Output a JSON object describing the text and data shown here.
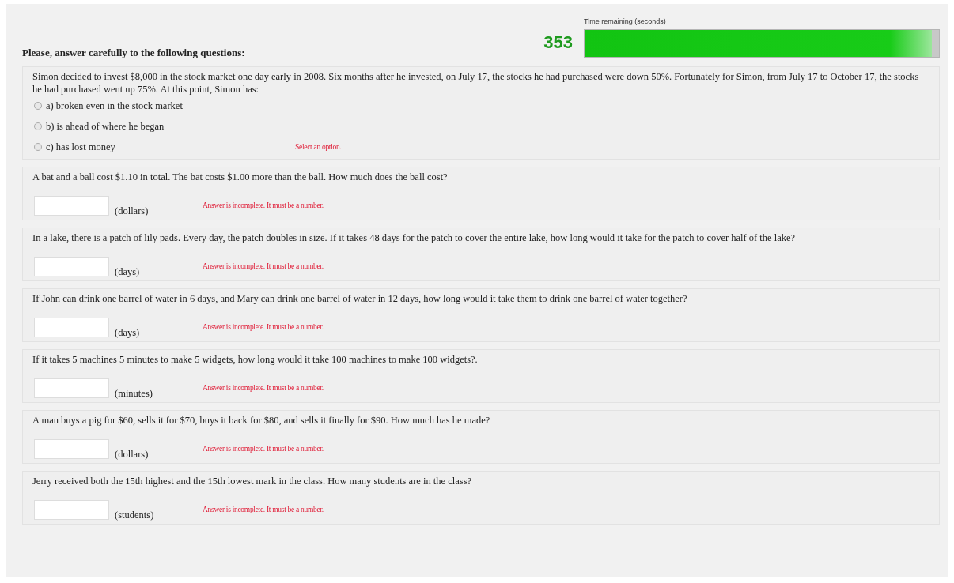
{
  "header": {
    "instruction": "Please, answer carefully to the following questions:"
  },
  "timer": {
    "label": "Time remaining (seconds)",
    "value": "353",
    "level": 0.98
  },
  "questions": [
    {
      "kind": "choice",
      "text": "Simon decided to invest $8,000 in the stock market one day early in 2008. Six months after he invested, on July 17, the stocks he had purchased were down 50%. Fortunately for Simon, from July 17 to October 17, the stocks he had purchased went up 75%. At this point, Simon has:",
      "options": [
        {
          "label": "a) broken even in the stock market",
          "selected": false
        },
        {
          "label": "b) is ahead of where he began",
          "selected": false
        },
        {
          "label": "c) has lost money",
          "selected": false
        }
      ],
      "error": "Select an option."
    },
    {
      "kind": "number",
      "text": "A bat and a ball cost $1.10 in total. The bat costs $1.00 more than the ball. How much does the ball cost?",
      "unit": "(dollars)",
      "error": "Answer is incomplete. It must be a number."
    },
    {
      "kind": "number",
      "text": "In a lake, there is a patch of lily pads. Every day, the patch doubles in size. If it takes 48 days for the patch to cover the entire lake, how long would it take for the patch to cover half of the lake?",
      "unit": "(days)",
      "error": "Answer is incomplete. It must be a number."
    },
    {
      "kind": "number",
      "text": "If John can drink one barrel of water in 6 days, and Mary can drink one barrel of water in 12 days, how long would it take them to drink one barrel of water together?",
      "unit": "(days)",
      "error": "Answer is incomplete. It must be a number."
    },
    {
      "kind": "number",
      "text": "If it takes 5 machines 5 minutes to make 5 widgets, how long would it take 100 machines to make 100 widgets?.",
      "unit": "(minutes)",
      "error": "Answer is incomplete. It must be a number."
    },
    {
      "kind": "number",
      "text": "A man buys a pig for $60, sells it for $70, buys it back for $80, and sells it finally for $90. How much has he made?",
      "unit": "(dollars)",
      "error": "Answer is incomplete. It must be a number."
    },
    {
      "kind": "number",
      "text": "Jerry received both the 15th highest and the 15th lowest mark in the class. How many students are in the class?",
      "unit": "(students)",
      "error": "Answer is incomplete. It must be a number."
    }
  ]
}
